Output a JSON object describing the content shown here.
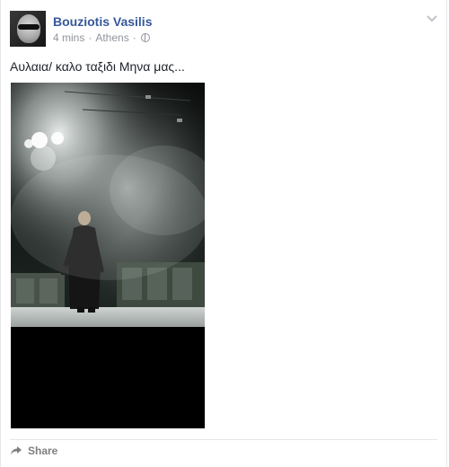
{
  "post": {
    "author_name": "Bouziotis Vasilis",
    "timestamp": "4 mins",
    "separator": "·",
    "location": "Athens",
    "privacy_icon": "globe-icon",
    "menu_icon": "chevron-down-icon",
    "text": "Αυλαια/ καλο ταξιδι Μηνα μας...",
    "photo_icon": "stage-photo"
  },
  "actions": {
    "share_label": "Share",
    "share_icon": "share-arrow-icon"
  },
  "colors": {
    "link": "#365899",
    "meta": "#90949c",
    "text": "#1d2129"
  }
}
